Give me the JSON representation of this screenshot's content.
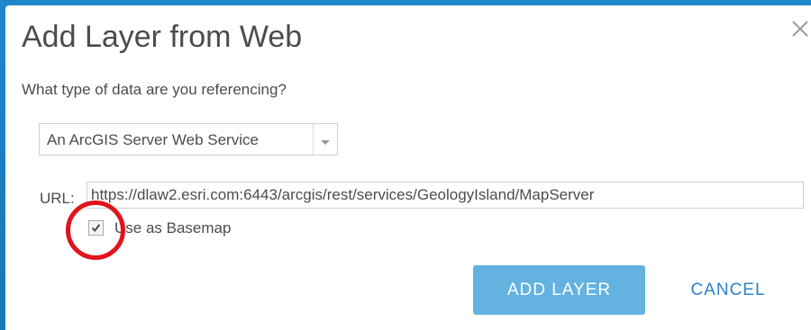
{
  "dialog": {
    "title": "Add Layer from Web",
    "close_icon": "close-icon"
  },
  "form": {
    "question": "What type of data are you referencing?",
    "data_type": {
      "selected": "An ArcGIS Server Web Service",
      "caret_icon": "chevron-down-icon"
    },
    "url": {
      "label": "URL:",
      "value": "https://dlaw2.esri.com:6443/arcgis/rest/services/GeologyIsland/MapServer"
    },
    "basemap": {
      "label": "Use as Basemap",
      "checked": true,
      "check_icon": "checkmark-icon"
    }
  },
  "actions": {
    "add_label": "ADD LAYER",
    "cancel_label": "CANCEL"
  },
  "colors": {
    "backdrop": "#1a7bc1",
    "primary_button": "#63b2e0",
    "link": "#2b83c7",
    "annotation": "#e0141c",
    "text": "#4c4c4c"
  }
}
